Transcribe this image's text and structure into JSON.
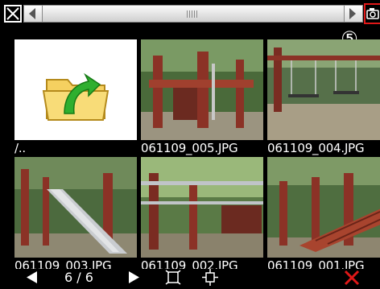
{
  "callout": "⑤",
  "items": [
    {
      "name": "/..",
      "kind": "parent-folder",
      "selected": false
    },
    {
      "name": "061109_005.JPG",
      "kind": "photo",
      "selected": false
    },
    {
      "name": "061109_004.JPG",
      "kind": "photo",
      "selected": false
    },
    {
      "name": "061109_003.JPG",
      "kind": "photo",
      "selected": false
    },
    {
      "name": "061109_002.JPG",
      "kind": "photo",
      "selected": false
    },
    {
      "name": "061109_001.JPG",
      "kind": "photo",
      "selected": true
    }
  ],
  "pager": {
    "text": "6 / 6"
  },
  "colors": {
    "accent": "#e01818",
    "background": "#000000",
    "scrollbar": "#e0e0e0"
  },
  "icons": [
    "close-box-icon",
    "scroll-left-arrow-icon",
    "scroll-right-arrow-icon",
    "camera-icon",
    "folder-up-icon",
    "prev-page-icon",
    "next-page-icon",
    "fit-frame-icon",
    "move-cross-icon",
    "delete-x-icon"
  ]
}
